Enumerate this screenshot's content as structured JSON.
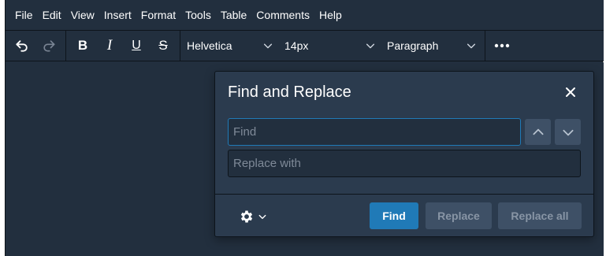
{
  "menubar": {
    "items": [
      {
        "label": "File"
      },
      {
        "label": "Edit"
      },
      {
        "label": "View"
      },
      {
        "label": "Insert"
      },
      {
        "label": "Format"
      },
      {
        "label": "Tools"
      },
      {
        "label": "Table"
      },
      {
        "label": "Comments"
      },
      {
        "label": "Help"
      }
    ]
  },
  "toolbar": {
    "undo_icon": "undo-icon",
    "redo_icon": "redo-icon",
    "redo_disabled": true,
    "bold_label": "B",
    "italic_label": "I",
    "underline_label": "U",
    "strike_label": "S",
    "font_family": "Helvetica",
    "font_size": "14px",
    "block_format": "Paragraph",
    "more_icon": "more-icon"
  },
  "dialog": {
    "title": "Find and Replace",
    "find_placeholder": "Find",
    "find_value": "",
    "replace_placeholder": "Replace with",
    "replace_value": "",
    "find_button": "Find",
    "replace_button": "Replace",
    "replace_all_button": "Replace all"
  },
  "colors": {
    "background": "#222f3e",
    "dialog": "#2b3b4e",
    "primary": "#207ab7",
    "disabled_button": "#3e5066"
  }
}
